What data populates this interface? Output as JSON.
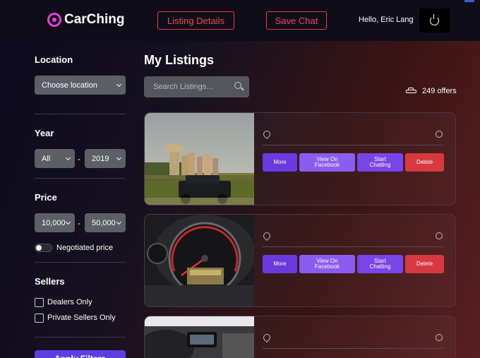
{
  "header": {
    "brand": "CarChing",
    "listing_details_label": "Listing Details",
    "save_chat_label": "Save Chat",
    "greeting": "Hello,  Eric Lang"
  },
  "sidebar": {
    "location_label": "Location",
    "location_value": "Choose location",
    "year_label": "Year",
    "year_from": "All",
    "year_to": "2019",
    "range_separator": "-",
    "price_label": "Price",
    "price_from": "10,000",
    "price_to": "50,000",
    "negotiated_label": "Negotiated price",
    "sellers_label": "Sellers",
    "dealers_label": "Dealers Only",
    "private_label": "Private Sellers Only",
    "apply_label": "Apply Filters"
  },
  "main": {
    "title": "My Listings",
    "search_placeholder": "Search Listings...",
    "offers_count": "249 offers"
  },
  "card_actions": {
    "more": "More",
    "facebook_line1": "View On",
    "facebook_line2": "Facebook",
    "chat_line1": "Start",
    "chat_line2": "Chatting",
    "delete": "Delete"
  },
  "colors": {
    "accent_red": "#e8344a",
    "accent_purple": "#6a3ae0",
    "delete_red": "#d8383f"
  }
}
